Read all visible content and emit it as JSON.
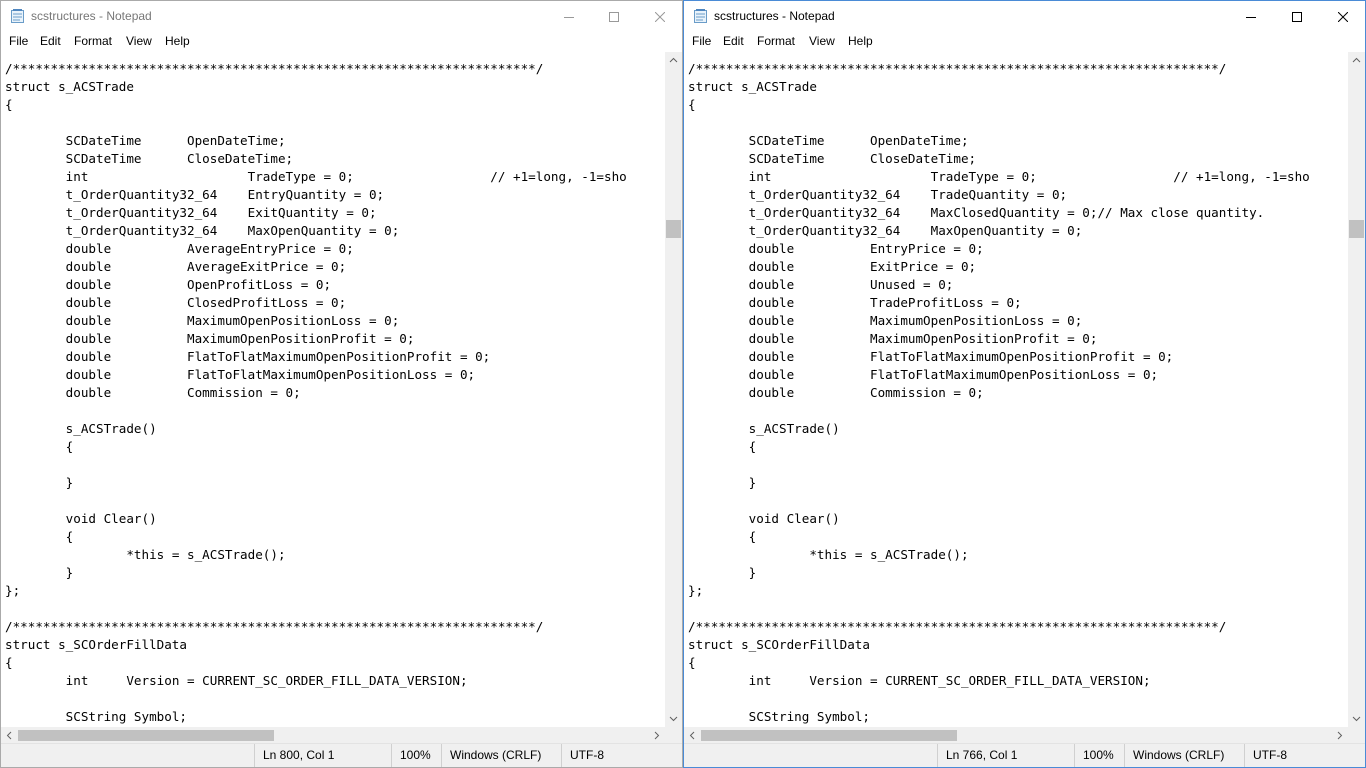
{
  "windows": [
    {
      "title": "scstructures - Notepad",
      "menu": [
        "File",
        "Edit",
        "Format",
        "View",
        "Help"
      ],
      "lines": [
        "/*********************************************************************/",
        "struct s_ACSTrade",
        "{",
        "",
        "\tSCDateTime\tOpenDateTime;",
        "\tSCDateTime\tCloseDateTime;",
        "\tint\t\t\tTradeType = 0;\t\t\t// +1=long, -1=sho",
        "\tt_OrderQuantity32_64\tEntryQuantity = 0;",
        "\tt_OrderQuantity32_64\tExitQuantity = 0;",
        "\tt_OrderQuantity32_64\tMaxOpenQuantity = 0;",
        "\tdouble\t\tAverageEntryPrice = 0;",
        "\tdouble\t\tAverageExitPrice = 0;",
        "\tdouble\t\tOpenProfitLoss = 0;",
        "\tdouble\t\tClosedProfitLoss = 0;",
        "\tdouble\t\tMaximumOpenPositionLoss = 0;",
        "\tdouble\t\tMaximumOpenPositionProfit = 0;",
        "\tdouble\t\tFlatToFlatMaximumOpenPositionProfit = 0;",
        "\tdouble\t\tFlatToFlatMaximumOpenPositionLoss = 0;",
        "\tdouble\t\tCommission = 0;",
        "",
        "\ts_ACSTrade()",
        "\t{",
        "",
        "\t}",
        "",
        "\tvoid Clear()",
        "\t{",
        "\t\t*this = s_ACSTrade();",
        "\t}",
        "};",
        "",
        "/*********************************************************************/",
        "struct s_SCOrderFillData",
        "{",
        "\tint\tVersion = CURRENT_SC_ORDER_FILL_DATA_VERSION;",
        "",
        "\tSCString Symbol;"
      ],
      "status": {
        "position": "Ln 800, Col 1",
        "zoom": "100%",
        "line_endings": "Windows (CRLF)",
        "encoding": "UTF-8"
      }
    },
    {
      "title": "scstructures - Notepad",
      "menu": [
        "File",
        "Edit",
        "Format",
        "View",
        "Help"
      ],
      "lines": [
        "/*********************************************************************/",
        "struct s_ACSTrade",
        "{",
        "",
        "\tSCDateTime\tOpenDateTime;",
        "\tSCDateTime\tCloseDateTime;",
        "\tint\t\t\tTradeType = 0;\t\t\t// +1=long, -1=sho",
        "\tt_OrderQuantity32_64\tTradeQuantity = 0;",
        "\tt_OrderQuantity32_64\tMaxClosedQuantity = 0;// Max close quantity.",
        "\tt_OrderQuantity32_64\tMaxOpenQuantity = 0;",
        "\tdouble\t\tEntryPrice = 0;",
        "\tdouble\t\tExitPrice = 0;",
        "\tdouble\t\tUnused = 0;",
        "\tdouble\t\tTradeProfitLoss = 0;",
        "\tdouble\t\tMaximumOpenPositionLoss = 0;",
        "\tdouble\t\tMaximumOpenPositionProfit = 0;",
        "\tdouble\t\tFlatToFlatMaximumOpenPositionProfit = 0;",
        "\tdouble\t\tFlatToFlatMaximumOpenPositionLoss = 0;",
        "\tdouble\t\tCommission = 0;",
        "",
        "\ts_ACSTrade()",
        "\t{",
        "",
        "\t}",
        "",
        "\tvoid Clear()",
        "\t{",
        "\t\t*this = s_ACSTrade();",
        "\t}",
        "};",
        "",
        "/*********************************************************************/",
        "struct s_SCOrderFillData",
        "{",
        "\tint\tVersion = CURRENT_SC_ORDER_FILL_DATA_VERSION;",
        "",
        "\tSCString Symbol;"
      ],
      "status": {
        "position": "Ln 766, Col 1",
        "zoom": "100%",
        "line_endings": "Windows (CRLF)",
        "encoding": "UTF-8"
      }
    }
  ],
  "icons": {
    "app": "notepad-icon",
    "minimize": "minimize-icon",
    "maximize": "maximize-icon",
    "close": "close-icon"
  }
}
